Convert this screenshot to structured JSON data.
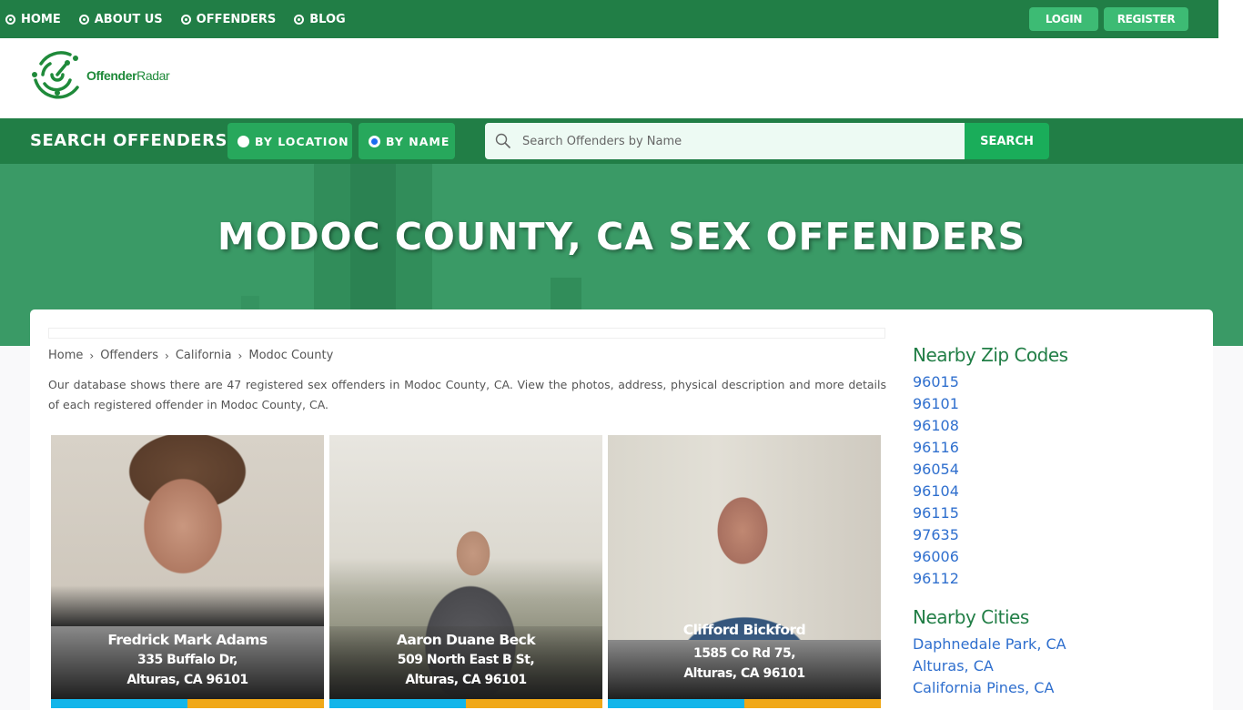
{
  "topnav": {
    "items": [
      {
        "label": "HOME",
        "icon": "radio-dot-icon"
      },
      {
        "label": "ABOUT US",
        "icon": "radio-dot-icon"
      },
      {
        "label": "OFFENDERS",
        "icon": "radio-dot-icon"
      },
      {
        "label": "BLOG",
        "icon": "radio-dot-icon"
      }
    ],
    "login_label": "LOGIN",
    "register_label": "REGISTER"
  },
  "brand": {
    "name_bold": "Offender",
    "name_light": "Radar",
    "icon": "radar-icon"
  },
  "search": {
    "title": "SEARCH OFFENDERS",
    "mode_location_label": "BY LOCATION",
    "mode_name_label": "BY NAME",
    "selected_mode": "BY NAME",
    "placeholder": "Search Offenders by Name",
    "value": "",
    "button_label": "SEARCH"
  },
  "hero": {
    "title": "MODOC COUNTY, CA SEX OFFENDERS"
  },
  "breadcrumb": [
    "Home",
    "Offenders",
    "California",
    "Modoc County"
  ],
  "intro": "Our database shows there are 47 registered sex offenders in Modoc County, CA. View the photos, address, physical description and more details of each registered offender in Modoc County, CA.",
  "offenders": [
    {
      "name": "Fredrick Mark Adams",
      "street": "335 Buffalo Dr,",
      "city": "Alturas, CA 96101"
    },
    {
      "name": "Aaron Duane Beck",
      "street": "509 North East B St,",
      "city": "Alturas, CA 96101"
    },
    {
      "name": "Clifford Bickford",
      "street": "1585 Co Rd 75,",
      "city": "Alturas, CA 96101"
    }
  ],
  "sidebar": {
    "zip_title": "Nearby Zip Codes",
    "zips": [
      "96015",
      "96101",
      "96108",
      "96116",
      "96054",
      "96104",
      "96115",
      "97635",
      "96006",
      "96112"
    ],
    "cities_title": "Nearby Cities",
    "cities": [
      "Daphnedale Park, CA",
      "Alturas, CA",
      "California Pines, CA"
    ]
  },
  "colors": {
    "brand_green": "#217e46",
    "button_green": "#3dbb74",
    "link_blue": "#2f6fce",
    "bar_blue": "#13b5ea",
    "bar_orange": "#f0a818"
  }
}
